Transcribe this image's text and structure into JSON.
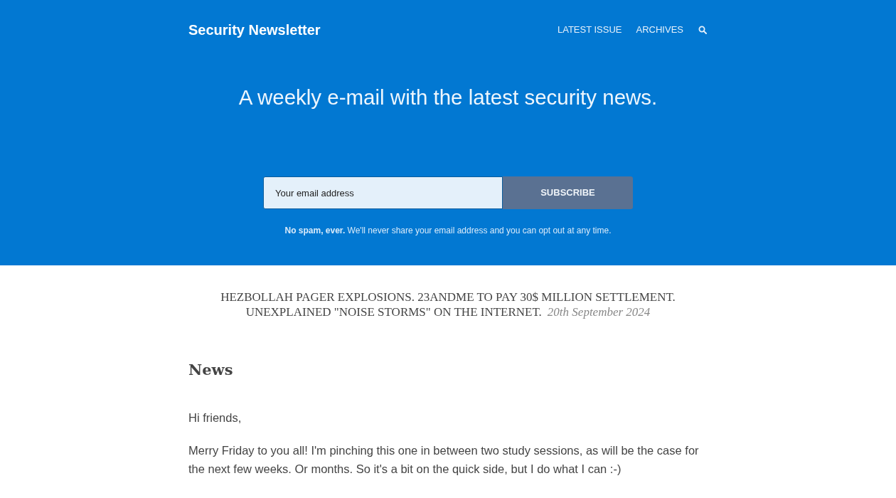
{
  "header": {
    "site_title": "Security Newsletter",
    "nav": [
      {
        "label": "LATEST ISSUE"
      },
      {
        "label": "ARCHIVES"
      }
    ]
  },
  "hero": {
    "headline": "A weekly e-mail with the latest security news.",
    "email_field": {
      "placeholder": "Your email address"
    },
    "subscribe_button": "SUBSCRIBE",
    "note": "**No spam, ever.** We'll never share your email address and you can opt out at any time."
  },
  "issue": {
    "headline_lines": [
      "HEZBOLLAH PAGER EXPLOSIONS. 23ANDME TO PAY 30$ MILLION SETTLEMENT.",
      "UNEXPLAINED \"NOISE STORMS\" ON THE INTERNET."
    ],
    "date": "20th September 2024"
  },
  "article": {
    "heading": "News",
    "paragraphs": [
      "Hi friends,",
      "Merry Friday to you all! I'm pinching this one in between two study sessions, as will be the case for the next few weeks. Or months. So it's a bit on the quick side, but I do what I can :-)"
    ]
  }
}
